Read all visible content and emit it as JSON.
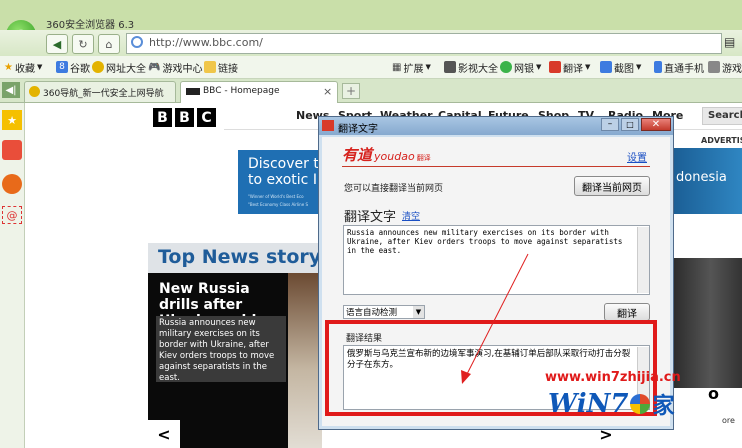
{
  "browser": {
    "title": "360安全浏览器 6.3",
    "address": "http://www.bbc.com/",
    "menu_glyph": "▤"
  },
  "toolbar": {
    "favorites": "收藏",
    "google": "谷歌",
    "url_directory": "网址大全",
    "game_center": "游戏中心",
    "links": "链接",
    "extensions": "扩展",
    "video": "影视大全",
    "netbank": "网银",
    "translate": "翻译",
    "screenshot": "截图",
    "mobile": "直通手机",
    "games": "游戏"
  },
  "tabs": [
    {
      "label": "360导航_新一代安全上网导航"
    },
    {
      "label": "BBC - Homepage"
    }
  ],
  "bbc": {
    "logo": [
      "B",
      "B",
      "C"
    ],
    "nav": [
      "News",
      "Sport",
      "Weather",
      "Capital",
      "Future",
      "Shop",
      "TV",
      "Radio",
      "More"
    ],
    "search": "Search",
    "ad_line1": "Discover th",
    "ad_line2": "to exotic In",
    "ad_small1": "\"Winner of World's Best Eco",
    "ad_small2": "\"Best Economy Class Airline S",
    "advertisement": "ADVERTIS",
    "ad_right": "donesia",
    "section_title": "Top News story",
    "headline": "New Russia drills after Ukraine raid",
    "summary": "Russia announces new military exercises on its border with Ukraine, after Kiev orders troops to move against separatists in the east.",
    "prev": "<",
    "next": ">",
    "side_text": "o",
    "more": "ore"
  },
  "dialog": {
    "title": "翻译文字",
    "brand_cn": "有道",
    "brand_en": "youdao",
    "brand_sub": "翻译",
    "settings": "设置",
    "direct_text": "您可以直接翻译当前网页",
    "translate_page_btn": "翻译当前网页",
    "section_label": "翻译文字",
    "clear": "清空",
    "source_text": "Russia announces new military exercises on its border with Ukraine, after Kiev orders troops to move against separatists in the east.",
    "lang_select": "语言自动检测",
    "translate_btn": "翻译",
    "result_label": "翻译结果",
    "result_text": "俄罗斯与乌克兰宣布新的边境军事演习,在基辅订单后部队采取行动打击分裂分子在东方。"
  },
  "watermark": {
    "url": "www.win7zhijia.cn",
    "brand": "WiN7",
    "brand2": "家"
  }
}
